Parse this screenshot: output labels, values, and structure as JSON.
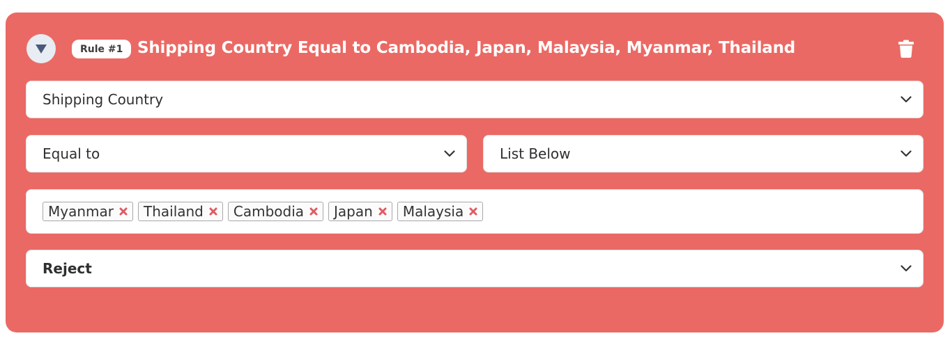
{
  "rule": {
    "badge": "Rule #1",
    "title": "Shipping Country Equal to Cambodia, Japan, Malaysia, Myanmar, Thailand",
    "field_select": "Shipping Country",
    "operator_select": "Equal to",
    "value_source_select": "List Below",
    "values": [
      "Myanmar",
      "Thailand",
      "Cambodia",
      "Japan",
      "Malaysia"
    ],
    "action_select": "Reject"
  },
  "icons": {
    "toggle": "triangle-down-icon",
    "delete": "trash-icon",
    "dropdown": "chevron-down-icon",
    "remove_tag": "close-icon"
  },
  "colors": {
    "card_background": "#eb6964",
    "toggle_background": "#e8ecf3",
    "toggle_arrow": "#4a5a78",
    "tag_remove": "#e05a63"
  }
}
